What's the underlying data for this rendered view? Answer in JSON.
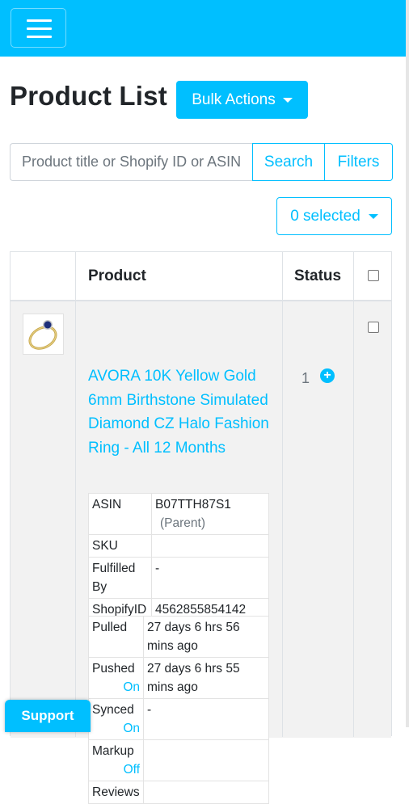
{
  "colors": {
    "accent": "#00bfff",
    "row_bg": "#f2f2f2"
  },
  "header": {
    "menu_icon": "hamburger-icon"
  },
  "page": {
    "title": "Product List",
    "bulk_actions_label": "Bulk Actions"
  },
  "search": {
    "placeholder": "Product title or Shopify ID or ASIN",
    "search_label": "Search",
    "filters_label": "Filters"
  },
  "selection": {
    "label": "0 selected"
  },
  "table": {
    "headers": {
      "product": "Product",
      "status": "Status"
    },
    "rows": [
      {
        "title": "AVORA 10K Yellow Gold 6mm Birthstone Simulated Diamond CZ Halo Fashion Ring - All 12 Months",
        "status_count": "1",
        "details": {
          "asin_label": "ASIN",
          "asin_value": "B07TTH87S1",
          "asin_note": "(Parent)",
          "sku_label": "SKU",
          "sku_value": "",
          "fulfilled_label": "Fulfilled By",
          "fulfilled_value": "-",
          "shopify_label": "ShopifyID",
          "shopify_value": "4562855854142"
        },
        "sync": {
          "pulled_label": "Pulled",
          "pulled_value": "27 days 6 hrs 56 mins ago",
          "pushed_label": "Pushed",
          "pushed_toggle": "On",
          "pushed_value": "27 days 6 hrs 55 mins ago",
          "synced_label": "Synced",
          "synced_toggle": "On",
          "synced_value": "-",
          "markup_label": "Markup",
          "markup_toggle": "Off",
          "markup_value": "",
          "reviews_label": "Reviews"
        }
      }
    ]
  },
  "support": {
    "label": "Support"
  }
}
